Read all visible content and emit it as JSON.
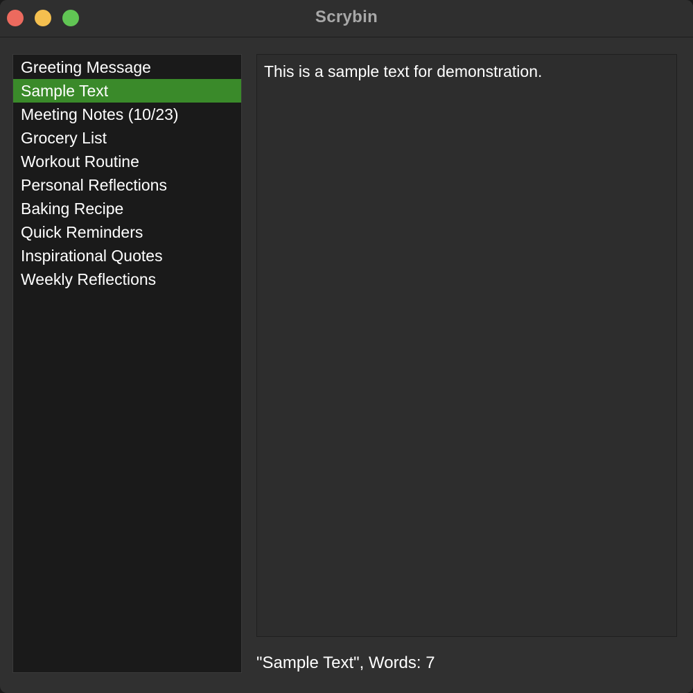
{
  "window": {
    "title": "Scrybin"
  },
  "sidebar": {
    "items": [
      {
        "label": "Greeting Message",
        "selected": false
      },
      {
        "label": "Sample Text",
        "selected": true
      },
      {
        "label": "Meeting Notes (10/23)",
        "selected": false
      },
      {
        "label": "Grocery List",
        "selected": false
      },
      {
        "label": "Workout Routine",
        "selected": false
      },
      {
        "label": "Personal Reflections",
        "selected": false
      },
      {
        "label": "Baking Recipe",
        "selected": false
      },
      {
        "label": "Quick Reminders",
        "selected": false
      },
      {
        "label": "Inspirational Quotes",
        "selected": false
      },
      {
        "label": "Weekly Reflections",
        "selected": false
      }
    ]
  },
  "editor": {
    "content": "This is a sample text for demonstration."
  },
  "status": {
    "text": "\"Sample Text\", Words: 7"
  },
  "colors": {
    "selection": "#3a8a2a",
    "close": "#ec6a5e",
    "minimize": "#f4bf4f",
    "zoom": "#61c554"
  }
}
